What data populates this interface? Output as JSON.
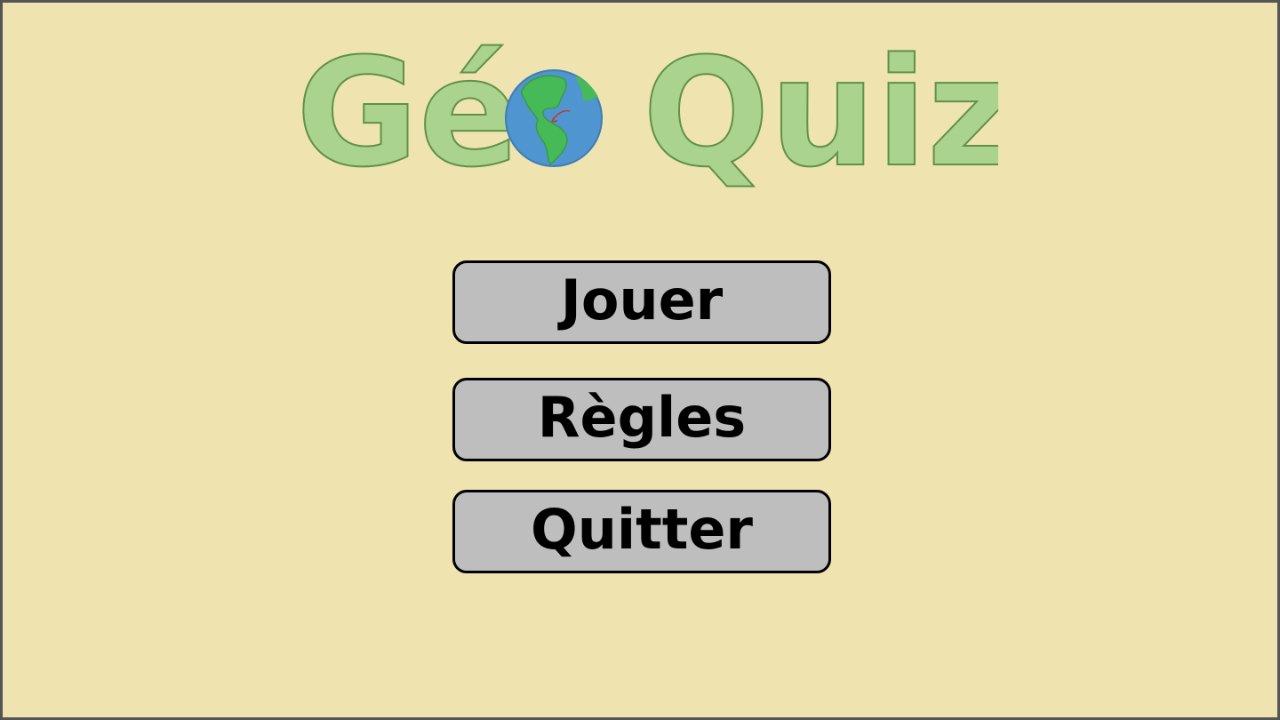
{
  "app": {
    "title_left": "Gé",
    "title_right": "Quiz",
    "colors": {
      "background": "#efe3b0",
      "title_fill": "#a9d38e",
      "title_outline": "#5f9147",
      "button_fill": "#bebebe",
      "globe_ocean": "#4f95cf",
      "globe_land": "#46ba57"
    }
  },
  "menu": {
    "play_label": "Jouer",
    "rules_label": "Règles",
    "quit_label": "Quitter"
  },
  "icons": {
    "title_o": "globe-icon"
  }
}
